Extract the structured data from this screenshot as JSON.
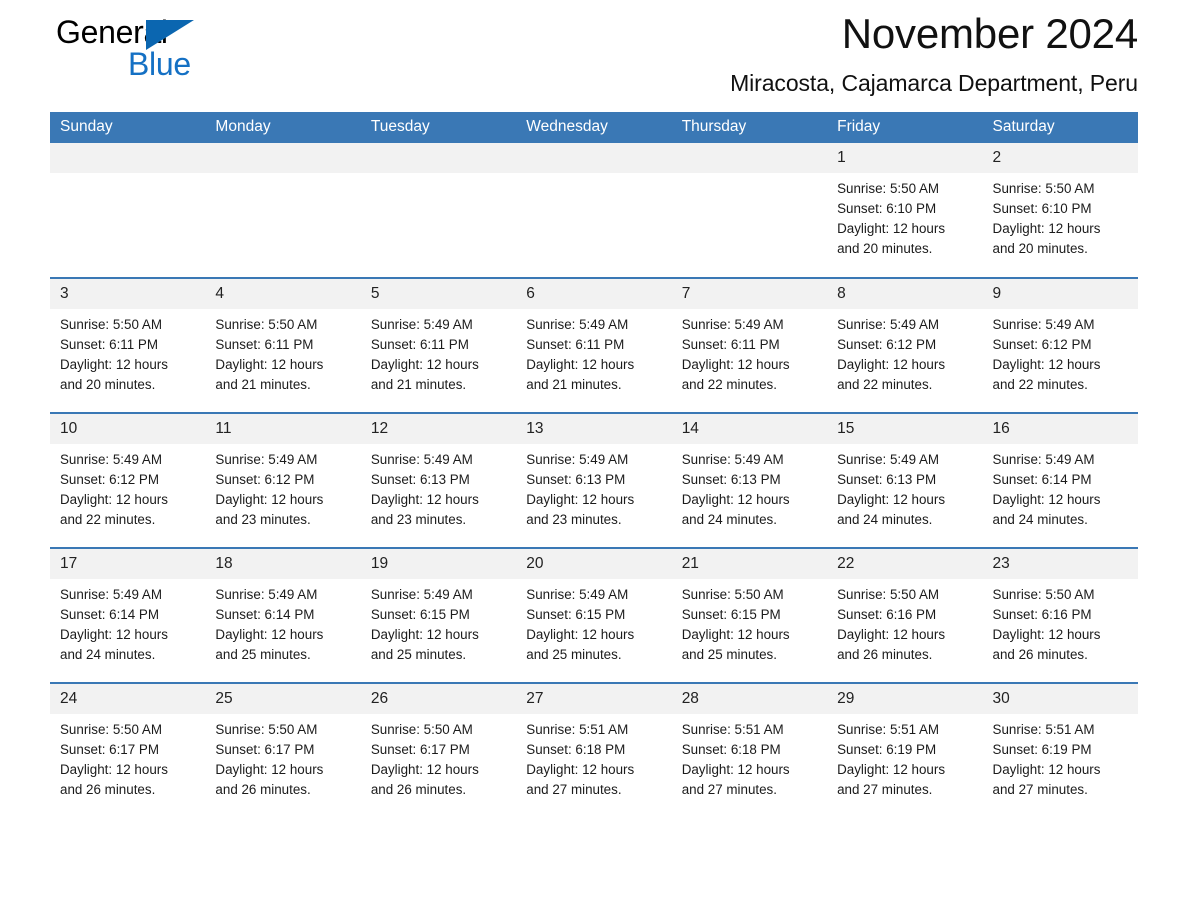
{
  "logo": {
    "word1": "General",
    "word2": "Blue",
    "triangle_color": "#0b66b0",
    "blue_color": "#1470c4"
  },
  "header": {
    "title": "November 2024",
    "location": "Miracosta, Cajamarca Department, Peru"
  },
  "theme": {
    "header_blue": "#3a78b5",
    "daynum_bg": "#f2f2f2",
    "page_bg": "#ffffff"
  },
  "weekday_headers": [
    "Sunday",
    "Monday",
    "Tuesday",
    "Wednesday",
    "Thursday",
    "Friday",
    "Saturday"
  ],
  "weeks": [
    [
      {
        "day": "",
        "sunrise": "",
        "sunset": "",
        "daylight1": "",
        "daylight2": "",
        "empty": true
      },
      {
        "day": "",
        "sunrise": "",
        "sunset": "",
        "daylight1": "",
        "daylight2": "",
        "empty": true
      },
      {
        "day": "",
        "sunrise": "",
        "sunset": "",
        "daylight1": "",
        "daylight2": "",
        "empty": true
      },
      {
        "day": "",
        "sunrise": "",
        "sunset": "",
        "daylight1": "",
        "daylight2": "",
        "empty": true
      },
      {
        "day": "",
        "sunrise": "",
        "sunset": "",
        "daylight1": "",
        "daylight2": "",
        "empty": true
      },
      {
        "day": "1",
        "sunrise": "Sunrise: 5:50 AM",
        "sunset": "Sunset: 6:10 PM",
        "daylight1": "Daylight: 12 hours",
        "daylight2": "and 20 minutes.",
        "empty": false
      },
      {
        "day": "2",
        "sunrise": "Sunrise: 5:50 AM",
        "sunset": "Sunset: 6:10 PM",
        "daylight1": "Daylight: 12 hours",
        "daylight2": "and 20 minutes.",
        "empty": false
      }
    ],
    [
      {
        "day": "3",
        "sunrise": "Sunrise: 5:50 AM",
        "sunset": "Sunset: 6:11 PM",
        "daylight1": "Daylight: 12 hours",
        "daylight2": "and 20 minutes.",
        "empty": false
      },
      {
        "day": "4",
        "sunrise": "Sunrise: 5:50 AM",
        "sunset": "Sunset: 6:11 PM",
        "daylight1": "Daylight: 12 hours",
        "daylight2": "and 21 minutes.",
        "empty": false
      },
      {
        "day": "5",
        "sunrise": "Sunrise: 5:49 AM",
        "sunset": "Sunset: 6:11 PM",
        "daylight1": "Daylight: 12 hours",
        "daylight2": "and 21 minutes.",
        "empty": false
      },
      {
        "day": "6",
        "sunrise": "Sunrise: 5:49 AM",
        "sunset": "Sunset: 6:11 PM",
        "daylight1": "Daylight: 12 hours",
        "daylight2": "and 21 minutes.",
        "empty": false
      },
      {
        "day": "7",
        "sunrise": "Sunrise: 5:49 AM",
        "sunset": "Sunset: 6:11 PM",
        "daylight1": "Daylight: 12 hours",
        "daylight2": "and 22 minutes.",
        "empty": false
      },
      {
        "day": "8",
        "sunrise": "Sunrise: 5:49 AM",
        "sunset": "Sunset: 6:12 PM",
        "daylight1": "Daylight: 12 hours",
        "daylight2": "and 22 minutes.",
        "empty": false
      },
      {
        "day": "9",
        "sunrise": "Sunrise: 5:49 AM",
        "sunset": "Sunset: 6:12 PM",
        "daylight1": "Daylight: 12 hours",
        "daylight2": "and 22 minutes.",
        "empty": false
      }
    ],
    [
      {
        "day": "10",
        "sunrise": "Sunrise: 5:49 AM",
        "sunset": "Sunset: 6:12 PM",
        "daylight1": "Daylight: 12 hours",
        "daylight2": "and 22 minutes.",
        "empty": false
      },
      {
        "day": "11",
        "sunrise": "Sunrise: 5:49 AM",
        "sunset": "Sunset: 6:12 PM",
        "daylight1": "Daylight: 12 hours",
        "daylight2": "and 23 minutes.",
        "empty": false
      },
      {
        "day": "12",
        "sunrise": "Sunrise: 5:49 AM",
        "sunset": "Sunset: 6:13 PM",
        "daylight1": "Daylight: 12 hours",
        "daylight2": "and 23 minutes.",
        "empty": false
      },
      {
        "day": "13",
        "sunrise": "Sunrise: 5:49 AM",
        "sunset": "Sunset: 6:13 PM",
        "daylight1": "Daylight: 12 hours",
        "daylight2": "and 23 minutes.",
        "empty": false
      },
      {
        "day": "14",
        "sunrise": "Sunrise: 5:49 AM",
        "sunset": "Sunset: 6:13 PM",
        "daylight1": "Daylight: 12 hours",
        "daylight2": "and 24 minutes.",
        "empty": false
      },
      {
        "day": "15",
        "sunrise": "Sunrise: 5:49 AM",
        "sunset": "Sunset: 6:13 PM",
        "daylight1": "Daylight: 12 hours",
        "daylight2": "and 24 minutes.",
        "empty": false
      },
      {
        "day": "16",
        "sunrise": "Sunrise: 5:49 AM",
        "sunset": "Sunset: 6:14 PM",
        "daylight1": "Daylight: 12 hours",
        "daylight2": "and 24 minutes.",
        "empty": false
      }
    ],
    [
      {
        "day": "17",
        "sunrise": "Sunrise: 5:49 AM",
        "sunset": "Sunset: 6:14 PM",
        "daylight1": "Daylight: 12 hours",
        "daylight2": "and 24 minutes.",
        "empty": false
      },
      {
        "day": "18",
        "sunrise": "Sunrise: 5:49 AM",
        "sunset": "Sunset: 6:14 PM",
        "daylight1": "Daylight: 12 hours",
        "daylight2": "and 25 minutes.",
        "empty": false
      },
      {
        "day": "19",
        "sunrise": "Sunrise: 5:49 AM",
        "sunset": "Sunset: 6:15 PM",
        "daylight1": "Daylight: 12 hours",
        "daylight2": "and 25 minutes.",
        "empty": false
      },
      {
        "day": "20",
        "sunrise": "Sunrise: 5:49 AM",
        "sunset": "Sunset: 6:15 PM",
        "daylight1": "Daylight: 12 hours",
        "daylight2": "and 25 minutes.",
        "empty": false
      },
      {
        "day": "21",
        "sunrise": "Sunrise: 5:50 AM",
        "sunset": "Sunset: 6:15 PM",
        "daylight1": "Daylight: 12 hours",
        "daylight2": "and 25 minutes.",
        "empty": false
      },
      {
        "day": "22",
        "sunrise": "Sunrise: 5:50 AM",
        "sunset": "Sunset: 6:16 PM",
        "daylight1": "Daylight: 12 hours",
        "daylight2": "and 26 minutes.",
        "empty": false
      },
      {
        "day": "23",
        "sunrise": "Sunrise: 5:50 AM",
        "sunset": "Sunset: 6:16 PM",
        "daylight1": "Daylight: 12 hours",
        "daylight2": "and 26 minutes.",
        "empty": false
      }
    ],
    [
      {
        "day": "24",
        "sunrise": "Sunrise: 5:50 AM",
        "sunset": "Sunset: 6:17 PM",
        "daylight1": "Daylight: 12 hours",
        "daylight2": "and 26 minutes.",
        "empty": false
      },
      {
        "day": "25",
        "sunrise": "Sunrise: 5:50 AM",
        "sunset": "Sunset: 6:17 PM",
        "daylight1": "Daylight: 12 hours",
        "daylight2": "and 26 minutes.",
        "empty": false
      },
      {
        "day": "26",
        "sunrise": "Sunrise: 5:50 AM",
        "sunset": "Sunset: 6:17 PM",
        "daylight1": "Daylight: 12 hours",
        "daylight2": "and 26 minutes.",
        "empty": false
      },
      {
        "day": "27",
        "sunrise": "Sunrise: 5:51 AM",
        "sunset": "Sunset: 6:18 PM",
        "daylight1": "Daylight: 12 hours",
        "daylight2": "and 27 minutes.",
        "empty": false
      },
      {
        "day": "28",
        "sunrise": "Sunrise: 5:51 AM",
        "sunset": "Sunset: 6:18 PM",
        "daylight1": "Daylight: 12 hours",
        "daylight2": "and 27 minutes.",
        "empty": false
      },
      {
        "day": "29",
        "sunrise": "Sunrise: 5:51 AM",
        "sunset": "Sunset: 6:19 PM",
        "daylight1": "Daylight: 12 hours",
        "daylight2": "and 27 minutes.",
        "empty": false
      },
      {
        "day": "30",
        "sunrise": "Sunrise: 5:51 AM",
        "sunset": "Sunset: 6:19 PM",
        "daylight1": "Daylight: 12 hours",
        "daylight2": "and 27 minutes.",
        "empty": false
      }
    ]
  ]
}
